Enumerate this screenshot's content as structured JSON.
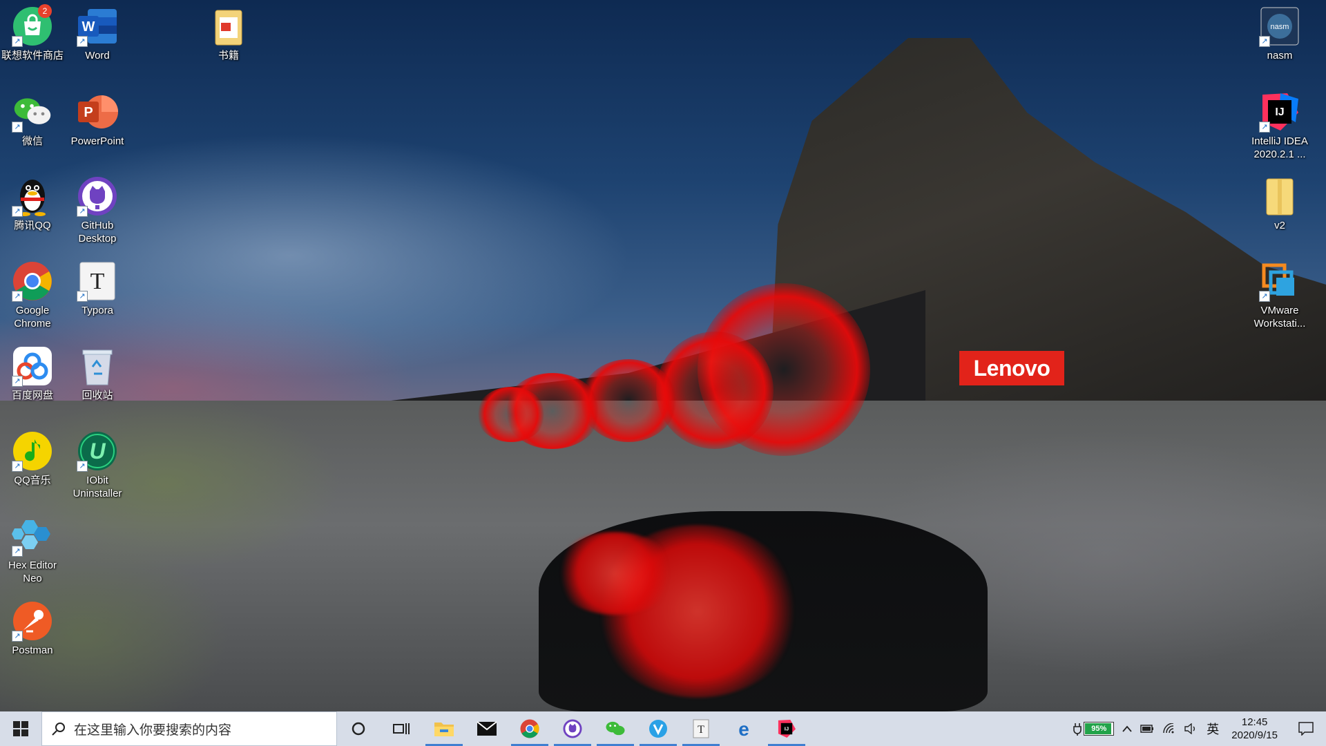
{
  "brand": {
    "logo_text": "Lenovo"
  },
  "desktop_icons": {
    "lenovo_store": {
      "label": "联想软件商店",
      "badge": "2"
    },
    "word": {
      "label": "Word"
    },
    "books": {
      "label": "书籍"
    },
    "nasm": {
      "label": "nasm"
    },
    "wechat": {
      "label": "微信"
    },
    "powerpoint": {
      "label": "PowerPoint"
    },
    "intellij": {
      "label": "IntelliJ IDEA 2020.2.1 ..."
    },
    "qq": {
      "label": "腾讯QQ"
    },
    "github": {
      "label": "GitHub Desktop"
    },
    "v2": {
      "label": "v2"
    },
    "chrome": {
      "label": "Google Chrome"
    },
    "typora": {
      "label": "Typora"
    },
    "vmware": {
      "label": "VMware Workstati..."
    },
    "baidu": {
      "label": "百度网盘"
    },
    "recycle": {
      "label": "回收站"
    },
    "qqmusic": {
      "label": "QQ音乐"
    },
    "iobit": {
      "label": "IObit Uninstaller"
    },
    "hexeditor": {
      "label": "Hex Editor Neo"
    },
    "postman": {
      "label": "Postman"
    }
  },
  "taskbar": {
    "search_placeholder": "在这里输入你要搜索的内容",
    "battery_percent": "95%",
    "battery_level": 0.95,
    "ime": "英",
    "time": "12:45",
    "date": "2020/9/15"
  },
  "colors": {
    "taskbar": "#d7dde8",
    "brand_red": "#e2231a",
    "active_indicator": "#3f7fd1"
  }
}
